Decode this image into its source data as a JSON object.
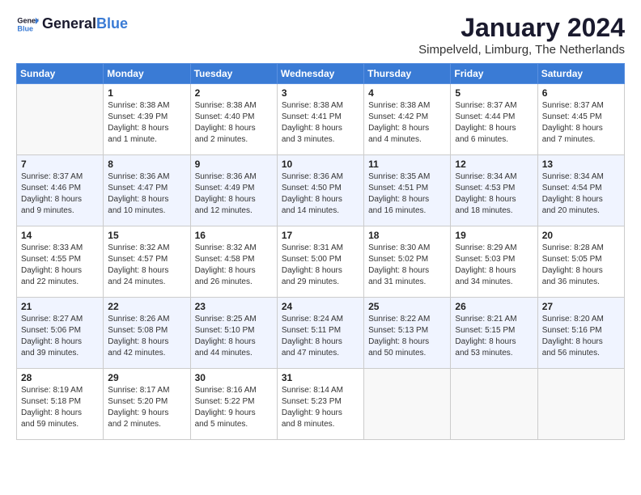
{
  "header": {
    "logo_line1": "General",
    "logo_line2": "Blue",
    "month": "January 2024",
    "location": "Simpelveld, Limburg, The Netherlands"
  },
  "days_of_week": [
    "Sunday",
    "Monday",
    "Tuesday",
    "Wednesday",
    "Thursday",
    "Friday",
    "Saturday"
  ],
  "weeks": [
    [
      {
        "num": "",
        "info": ""
      },
      {
        "num": "1",
        "info": "Sunrise: 8:38 AM\nSunset: 4:39 PM\nDaylight: 8 hours\nand 1 minute."
      },
      {
        "num": "2",
        "info": "Sunrise: 8:38 AM\nSunset: 4:40 PM\nDaylight: 8 hours\nand 2 minutes."
      },
      {
        "num": "3",
        "info": "Sunrise: 8:38 AM\nSunset: 4:41 PM\nDaylight: 8 hours\nand 3 minutes."
      },
      {
        "num": "4",
        "info": "Sunrise: 8:38 AM\nSunset: 4:42 PM\nDaylight: 8 hours\nand 4 minutes."
      },
      {
        "num": "5",
        "info": "Sunrise: 8:37 AM\nSunset: 4:44 PM\nDaylight: 8 hours\nand 6 minutes."
      },
      {
        "num": "6",
        "info": "Sunrise: 8:37 AM\nSunset: 4:45 PM\nDaylight: 8 hours\nand 7 minutes."
      }
    ],
    [
      {
        "num": "7",
        "info": "Sunrise: 8:37 AM\nSunset: 4:46 PM\nDaylight: 8 hours\nand 9 minutes."
      },
      {
        "num": "8",
        "info": "Sunrise: 8:36 AM\nSunset: 4:47 PM\nDaylight: 8 hours\nand 10 minutes."
      },
      {
        "num": "9",
        "info": "Sunrise: 8:36 AM\nSunset: 4:49 PM\nDaylight: 8 hours\nand 12 minutes."
      },
      {
        "num": "10",
        "info": "Sunrise: 8:36 AM\nSunset: 4:50 PM\nDaylight: 8 hours\nand 14 minutes."
      },
      {
        "num": "11",
        "info": "Sunrise: 8:35 AM\nSunset: 4:51 PM\nDaylight: 8 hours\nand 16 minutes."
      },
      {
        "num": "12",
        "info": "Sunrise: 8:34 AM\nSunset: 4:53 PM\nDaylight: 8 hours\nand 18 minutes."
      },
      {
        "num": "13",
        "info": "Sunrise: 8:34 AM\nSunset: 4:54 PM\nDaylight: 8 hours\nand 20 minutes."
      }
    ],
    [
      {
        "num": "14",
        "info": "Sunrise: 8:33 AM\nSunset: 4:55 PM\nDaylight: 8 hours\nand 22 minutes."
      },
      {
        "num": "15",
        "info": "Sunrise: 8:32 AM\nSunset: 4:57 PM\nDaylight: 8 hours\nand 24 minutes."
      },
      {
        "num": "16",
        "info": "Sunrise: 8:32 AM\nSunset: 4:58 PM\nDaylight: 8 hours\nand 26 minutes."
      },
      {
        "num": "17",
        "info": "Sunrise: 8:31 AM\nSunset: 5:00 PM\nDaylight: 8 hours\nand 29 minutes."
      },
      {
        "num": "18",
        "info": "Sunrise: 8:30 AM\nSunset: 5:02 PM\nDaylight: 8 hours\nand 31 minutes."
      },
      {
        "num": "19",
        "info": "Sunrise: 8:29 AM\nSunset: 5:03 PM\nDaylight: 8 hours\nand 34 minutes."
      },
      {
        "num": "20",
        "info": "Sunrise: 8:28 AM\nSunset: 5:05 PM\nDaylight: 8 hours\nand 36 minutes."
      }
    ],
    [
      {
        "num": "21",
        "info": "Sunrise: 8:27 AM\nSunset: 5:06 PM\nDaylight: 8 hours\nand 39 minutes."
      },
      {
        "num": "22",
        "info": "Sunrise: 8:26 AM\nSunset: 5:08 PM\nDaylight: 8 hours\nand 42 minutes."
      },
      {
        "num": "23",
        "info": "Sunrise: 8:25 AM\nSunset: 5:10 PM\nDaylight: 8 hours\nand 44 minutes."
      },
      {
        "num": "24",
        "info": "Sunrise: 8:24 AM\nSunset: 5:11 PM\nDaylight: 8 hours\nand 47 minutes."
      },
      {
        "num": "25",
        "info": "Sunrise: 8:22 AM\nSunset: 5:13 PM\nDaylight: 8 hours\nand 50 minutes."
      },
      {
        "num": "26",
        "info": "Sunrise: 8:21 AM\nSunset: 5:15 PM\nDaylight: 8 hours\nand 53 minutes."
      },
      {
        "num": "27",
        "info": "Sunrise: 8:20 AM\nSunset: 5:16 PM\nDaylight: 8 hours\nand 56 minutes."
      }
    ],
    [
      {
        "num": "28",
        "info": "Sunrise: 8:19 AM\nSunset: 5:18 PM\nDaylight: 8 hours\nand 59 minutes."
      },
      {
        "num": "29",
        "info": "Sunrise: 8:17 AM\nSunset: 5:20 PM\nDaylight: 9 hours\nand 2 minutes."
      },
      {
        "num": "30",
        "info": "Sunrise: 8:16 AM\nSunset: 5:22 PM\nDaylight: 9 hours\nand 5 minutes."
      },
      {
        "num": "31",
        "info": "Sunrise: 8:14 AM\nSunset: 5:23 PM\nDaylight: 9 hours\nand 8 minutes."
      },
      {
        "num": "",
        "info": ""
      },
      {
        "num": "",
        "info": ""
      },
      {
        "num": "",
        "info": ""
      }
    ]
  ]
}
